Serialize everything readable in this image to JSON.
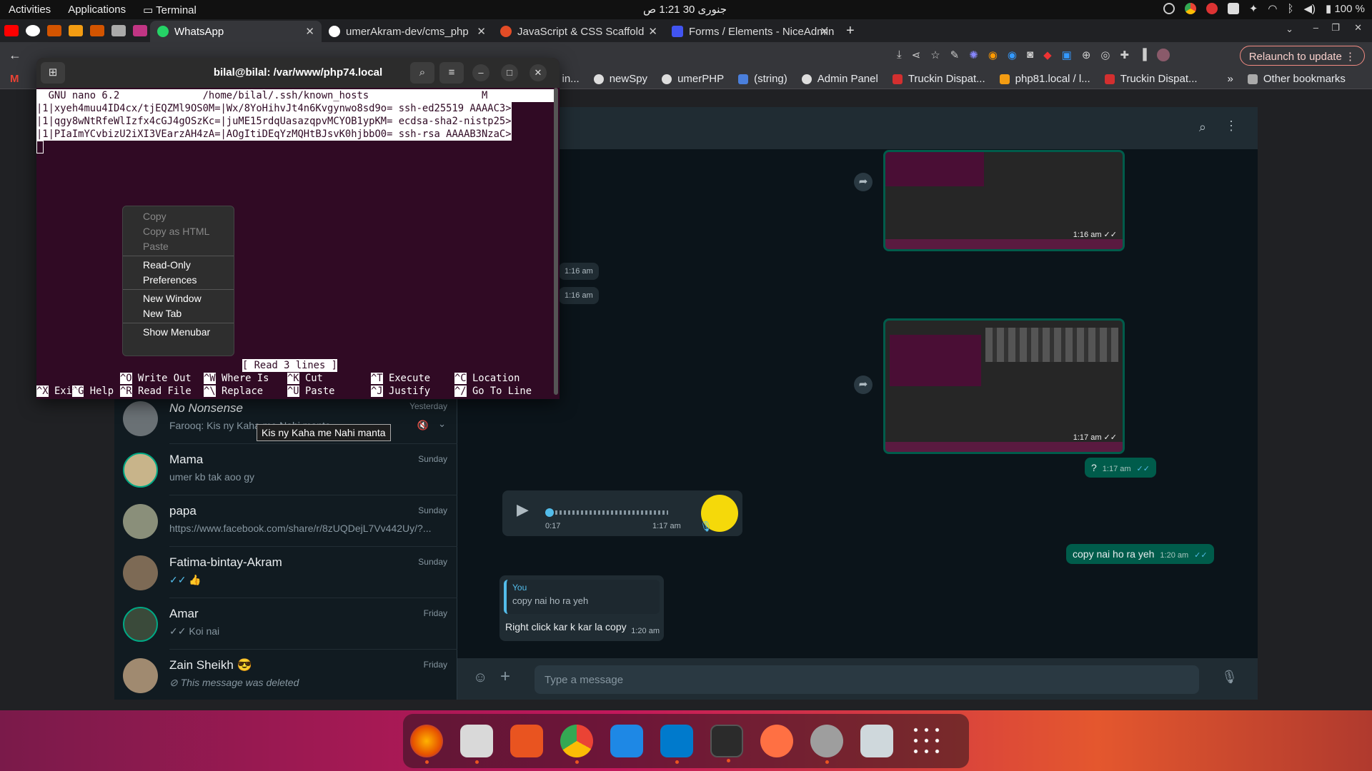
{
  "topbar": {
    "activities": "Activities",
    "applications": "Applications",
    "terminal": "Terminal",
    "clock": "جنوری 30  1:21 ص",
    "battery": "100 %"
  },
  "chrome": {
    "tabs": [
      {
        "label": "WhatsApp",
        "active": true
      },
      {
        "label": "umerAkram-dev/cms_php",
        "active": false
      },
      {
        "label": "JavaScript & CSS Scaffold",
        "active": false
      },
      {
        "label": "Forms / Elements - NiceAdmin",
        "active": false
      }
    ],
    "relaunch": "Relaunch to update",
    "bookmarks": [
      "in...",
      "newSpy",
      "umerPHP",
      "(string)",
      "Admin Panel",
      "Truckin Dispat...",
      "php81.local / l...",
      "Truckin Dispat..."
    ],
    "other_bookmarks": "Other bookmarks",
    "overflow": "»"
  },
  "terminal": {
    "title": "bilal@bilal: /var/www/php74.local",
    "nano_header": "  GNU nano 6.2              /home/bilal/.ssh/known_hosts                   M",
    "lines": [
      "|1|xyeh4muu4ID4cx/tjEQZMl9OS0M=|Wx/8YoHihvJt4n6Kvgynwo8sd9o= ssh-ed25519 AAAAC3>",
      "|1|qgy8wNtRfeWlIzfx4cGJ4gOSzKc=|juME15rdqUasazqpvMCYOB1ypKM= ecdsa-sha2-nistp25>",
      "|1|PIaImYCvbizU2iXI3VEarzAH4zA=|AOgItiDEqYzMQHtBJsvK0hjbbO0= ssh-rsa AAAAB3NzaC>"
    ],
    "status": "[ Read 3 lines ]",
    "shortcuts_row1": [
      {
        "key": "^G",
        "label": "Help"
      },
      {
        "key": "^O",
        "label": "Write Out"
      },
      {
        "key": "^W",
        "label": "Where Is"
      },
      {
        "key": "^K",
        "label": "Cut"
      },
      {
        "key": "^T",
        "label": "Execute"
      },
      {
        "key": "^C",
        "label": "Location"
      }
    ],
    "shortcuts_row2": [
      {
        "key": "^X",
        "label": "Exit"
      },
      {
        "key": "^R",
        "label": "Read File"
      },
      {
        "key": "^\\",
        "label": "Replace"
      },
      {
        "key": "^U",
        "label": "Paste"
      },
      {
        "key": "^J",
        "label": "Justify"
      },
      {
        "key": "^/",
        "label": "Go To Line"
      }
    ],
    "context_menu": {
      "copy": "Copy",
      "copy_html": "Copy as HTML",
      "paste": "Paste",
      "read_only": "Read-Only",
      "preferences": "Preferences",
      "new_window": "New Window",
      "new_tab": "New Tab",
      "show_menubar": "Show Menubar"
    }
  },
  "whatsapp": {
    "chats": [
      {
        "name": "No Nonsense",
        "preview": "Farooq: Kis ny Kaha me Nahi manta",
        "time": "Yesterday"
      },
      {
        "name": "Mama",
        "preview": "umer kb tak aoo gy",
        "time": "Sunday"
      },
      {
        "name": "papa",
        "preview": "https://www.facebook.com/share/r/8zUQDejL7Vv442Uy/?...",
        "time": "Sunday"
      },
      {
        "name": "Fatima-bintay-Akram",
        "preview": "✓✓ 👍",
        "time": "Sunday"
      },
      {
        "name": "Amar",
        "preview": "✓✓ Koi nai",
        "time": "Friday"
      },
      {
        "name": "Zain Sheikh 😎",
        "preview": "⊘ This message was deleted",
        "time": "Friday"
      }
    ],
    "tooltip": "Kis ny Kaha me Nahi manta",
    "messages": {
      "t1": "1:16 am",
      "t2": "1:16 am",
      "shot1_time": "1:16 am",
      "shot2_time": "1:17 am",
      "q": "?",
      "q_time": "1:17 am",
      "voice_duration": "0:17",
      "voice_time": "1:17 am",
      "copy_text": "copy nai ho ra yeh",
      "copy_time": "1:20 am",
      "reply_author": "You",
      "reply_quote": "copy nai ho ra yeh",
      "reply_text": "Right click kar k kar la copy",
      "reply_time": "1:20 am"
    },
    "input_placeholder": "Type a message"
  },
  "colors": {
    "terminal_bg": "#300a24",
    "wa_outgoing": "#005c4b",
    "wa_bg": "#0b141a",
    "chrome_bg": "#202124"
  }
}
